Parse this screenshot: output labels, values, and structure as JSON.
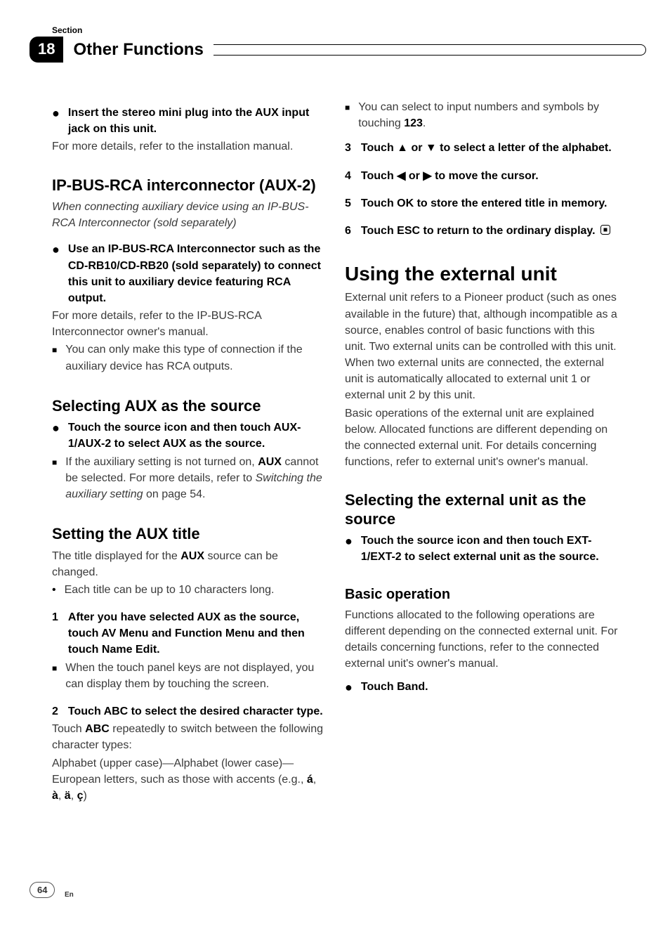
{
  "header": {
    "sectionLabel": "Section",
    "sectionNumber": "18",
    "chapterTitle": "Other Functions"
  },
  "left": {
    "b1": {
      "boldLine": "Insert the stereo mini plug into the AUX input jack on this unit.",
      "text": "For more details, refer to the installation manual."
    },
    "h2a_pre": "IP-BUS-RCA interconnector (",
    "h2a_aux": "AUX-2",
    "h2a_post": ")",
    "h2a_sub": "When connecting auxiliary device using an IP-BUS-RCA Interconnector (sold separately)",
    "b2": {
      "boldLine": "Use an IP-BUS-RCA Interconnector such as the CD-RB10/CD-RB20 (sold separately) to connect this unit to auxiliary device featuring RCA output.",
      "text": "For more details, refer to the IP-BUS-RCA Interconnector owner's manual.",
      "sub": "You can only make this type of connection if the auxiliary device has RCA outputs."
    },
    "h2b": "Selecting AUX as the source",
    "b3": {
      "boldLine": "Touch the source icon and then touch AUX-1/AUX-2 to select AUX as the source.",
      "sub_pre": "If the auxiliary setting is not turned on, ",
      "sub_aux": "AUX",
      "sub_mid": " cannot be selected. For more details, refer to ",
      "sub_italic": "Switching the auxiliary setting",
      "sub_post": " on page 54."
    },
    "h2c": "Setting the AUX title",
    "c_text_pre": "The title displayed for the ",
    "c_aux": "AUX",
    "c_text_post": " source can be changed.",
    "c_bullet": "Each title can be up to 10 characters long.",
    "step1": {
      "bold": "After you have selected AUX as the source, touch AV Menu and Function Menu and then touch Name Edit.",
      "sub": "When the touch panel keys are not displayed, you can display them by touching the screen."
    },
    "step2": {
      "bold": "Touch ABC to select the desired character type.",
      "t1_pre": "Touch ",
      "t1_abc": "ABC",
      "t1_post": " repeatedly to switch between the following character types:",
      "t2_pre": "Alphabet (upper case)—Alphabet (lower case)—European letters, such as those with accents (e.g., ",
      "t2_a1": "á",
      "t2_a2": "à",
      "t2_a3": "ä",
      "t2_a4": "ç",
      "t2_post": ")"
    }
  },
  "right": {
    "r0_pre": "You can select to input numbers and symbols by touching ",
    "r0_123": "123",
    "r0_post": ".",
    "step3": "Touch ▲ or ▼ to select a letter of the alphabet.",
    "step4": "Touch ◀ or ▶ to move the cursor.",
    "step5": "Touch OK to store the entered title in memory.",
    "step6": "Touch ESC to return to the ordinary display.",
    "h1": "Using the external unit",
    "h1_text": "External unit refers to a Pioneer product (such as ones available in the future) that, although incompatible as a source, enables control of basic functions with this unit. Two external units can be controlled with this unit. When two external units are connected, the external unit is automatically allocated to external unit 1 or external unit 2 by this unit.",
    "h1_text2": "Basic operations of the external unit are explained below. Allocated functions are different depending on the connected external unit. For details concerning functions, refer to external unit's owner's manual.",
    "h2d": "Selecting the external unit as the source",
    "b4": "Touch the source icon and then touch EXT-1/EXT-2 to select external unit as the source.",
    "h3": "Basic operation",
    "h3_text": "Functions allocated to the following operations are different depending on the connected external unit. For details concerning functions, refer to the connected external unit's owner's manual.",
    "b5": "Touch Band."
  },
  "footer": {
    "page": "64",
    "lang": "En"
  }
}
